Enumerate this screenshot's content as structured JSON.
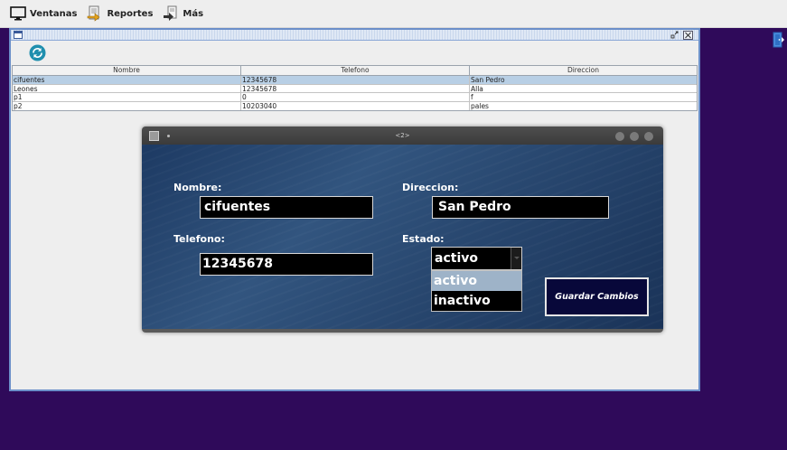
{
  "menubar": {
    "items": [
      {
        "label": "Ventanas",
        "icon": "monitor-icon"
      },
      {
        "label": "Reportes",
        "icon": "report-arrow-icon"
      },
      {
        "label": "Más",
        "icon": "document-arrow-icon"
      }
    ]
  },
  "frame": {
    "refresh_icon": "refresh-icon"
  },
  "table": {
    "columns": [
      "Nombre",
      "Telefono",
      "Direccion"
    ],
    "rows": [
      [
        "cifuentes",
        "12345678",
        "San Pedro"
      ],
      [
        "Leones",
        "12345678",
        "Alla"
      ],
      [
        "p1",
        "0",
        "f"
      ],
      [
        "p2",
        "10203040",
        "pales"
      ]
    ],
    "selected_row": 0
  },
  "dialog": {
    "title": "<2>",
    "labels": {
      "nombre": "Nombre:",
      "direccion": "Direccion:",
      "telefono": "Telefono:",
      "estado": "Estado:"
    },
    "values": {
      "nombre": "cifuentes",
      "direccion": "San Pedro",
      "telefono": "12345678",
      "estado": "activo"
    },
    "estado_options": [
      "activo",
      "inactivo"
    ],
    "save_label": "Guardar Cambios"
  },
  "colors": {
    "desktop": "#2f0a5a",
    "frame_border": "#6c8fc9",
    "selected_row": "#b8cfe5",
    "dialog_body": "#28476f",
    "save_button": "#08083a"
  }
}
